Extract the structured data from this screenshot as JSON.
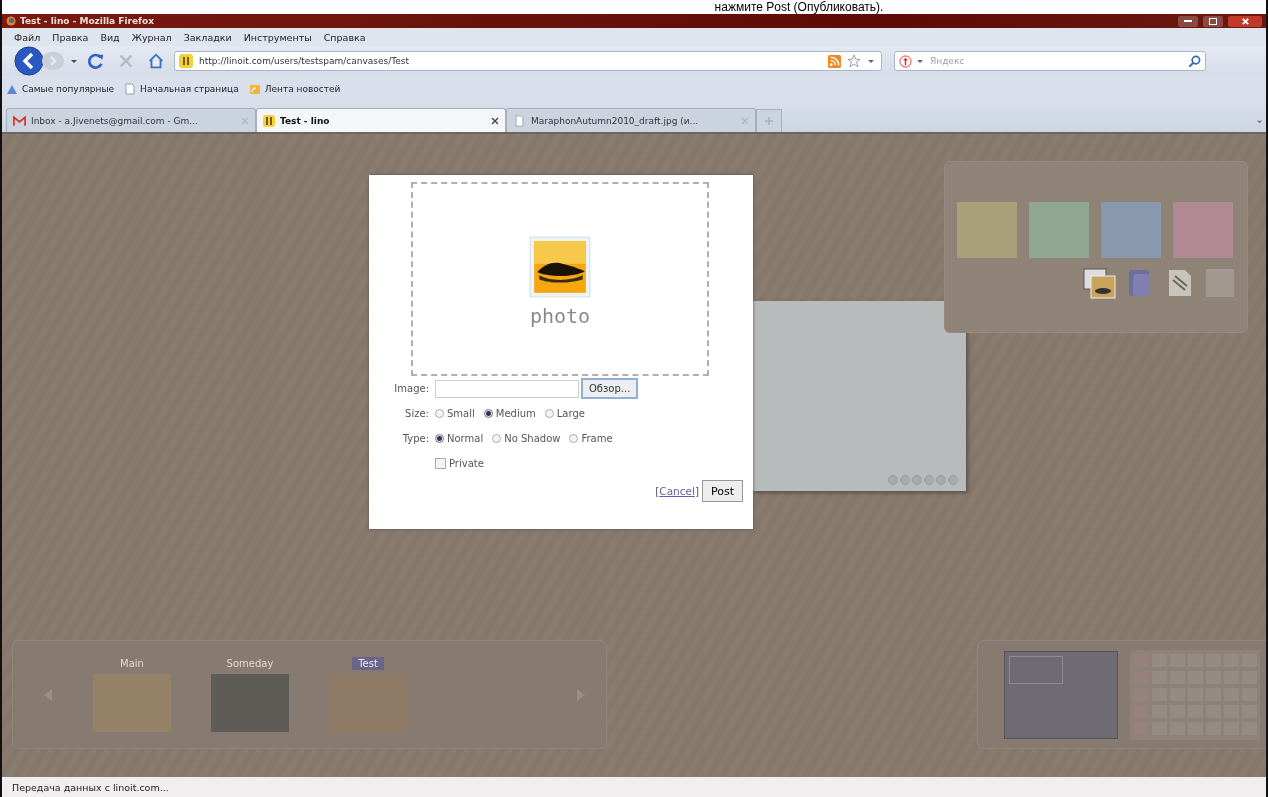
{
  "caption": "нажмите Post (Опубликовать).",
  "window": {
    "title": "Test - lino - Mozilla Firefox"
  },
  "menu": [
    "Файл",
    "Правка",
    "Вид",
    "Журнал",
    "Закладки",
    "Инструменты",
    "Справка"
  ],
  "address_bar": {
    "url": "http://linoit.com/users/testspam/canvases/Test"
  },
  "search": {
    "placeholder": "Яндекс"
  },
  "bookmarks": [
    {
      "label": "Самые популярные",
      "kind": "smart"
    },
    {
      "label": "Начальная страница",
      "kind": "page"
    },
    {
      "label": "Лента новостей",
      "kind": "feed"
    }
  ],
  "tabs": [
    {
      "label": "Inbox - a.Jivenets@gmail.com - Gm...",
      "kind": "gmail",
      "selected": false
    },
    {
      "label": "Test - lino",
      "kind": "lino",
      "selected": true
    },
    {
      "label": "MaraphonAutumn2010_draft.jpg (и...",
      "kind": "page",
      "selected": false
    }
  ],
  "dialog": {
    "placeholder_label": "photo",
    "image_label": "Image:",
    "browse_button": "Обзор...",
    "size_label": "Size:",
    "size_options": [
      {
        "label": "Small",
        "selected": false
      },
      {
        "label": "Medium",
        "selected": true
      },
      {
        "label": "Large",
        "selected": false
      }
    ],
    "type_label": "Type:",
    "type_options": [
      {
        "label": "Normal",
        "selected": true
      },
      {
        "label": "No Shadow",
        "selected": false
      },
      {
        "label": "Frame",
        "selected": false
      }
    ],
    "private": {
      "label": "Private",
      "checked": false
    },
    "cancel": {
      "open": "[",
      "label": "Cancel",
      "close": "]"
    },
    "post_button": "Post"
  },
  "board_tabs": [
    {
      "label": "Main",
      "selected": false
    },
    {
      "label": "Someday",
      "selected": false
    },
    {
      "label": "Test",
      "selected": true
    }
  ],
  "status_bar": "Передача данных с linoit.com..."
}
